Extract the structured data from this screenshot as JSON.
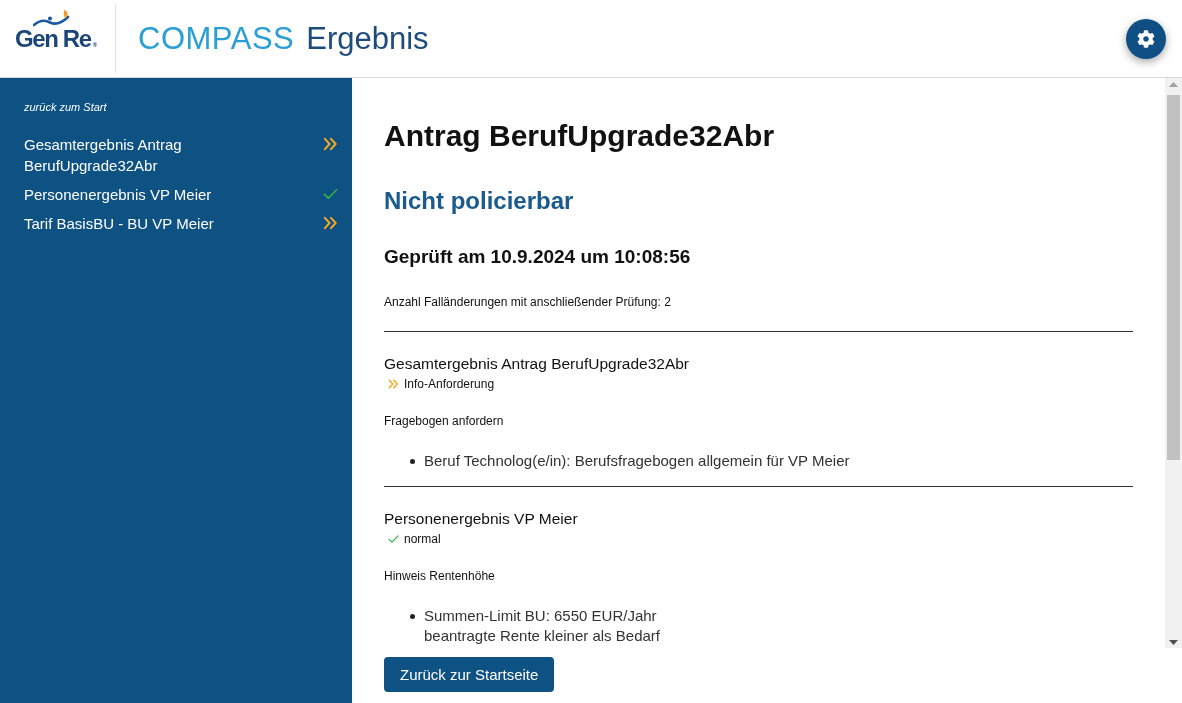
{
  "header": {
    "logo": "Gen Re$_{®}$",
    "product": "COMPASS",
    "title": "Ergebnis"
  },
  "sidebar": {
    "back_link": "zurück zum Start",
    "items": [
      {
        "label": "Gesamtergebnis Antrag BerufUpgrade32Abr",
        "kind": "info"
      },
      {
        "label": "Personenergebnis VP Meier",
        "kind": "ok"
      },
      {
        "label": "Tarif BasisBU - BU VP Meier",
        "kind": "info"
      }
    ]
  },
  "main": {
    "title": "Antrag BerufUpgrade32Abr",
    "verdict": "Nicht policierbar",
    "checked_at": "Geprüft am 10.9.2024 um 10:08:56",
    "changes_note": "Anzahl Falländerungen mit anschließender Prüfung: 2",
    "sections": [
      {
        "title": "Gesamtergebnis Antrag BerufUpgrade32Abr",
        "status": {
          "kind": "info",
          "label": "Info-Anforderung"
        },
        "notes": [
          {
            "heading": "Fragebogen anfordern",
            "items": [
              {
                "lines": [
                  "Beruf Technolog(e/in): Berufsfragebogen allgemein für VP Meier"
                ]
              }
            ]
          }
        ]
      },
      {
        "title": "Personenergebnis VP Meier",
        "status": {
          "kind": "ok",
          "label": "normal"
        },
        "notes": [
          {
            "heading": "Hinweis Rentenhöhe",
            "items": [
              {
                "lines": [
                  "Summen-Limit BU: 6550 EUR/Jahr",
                  "beantragte Rente kleiner als Bedarf"
                ]
              }
            ]
          }
        ]
      }
    ]
  },
  "footer": {
    "button": "Zurück zur Startseite"
  }
}
